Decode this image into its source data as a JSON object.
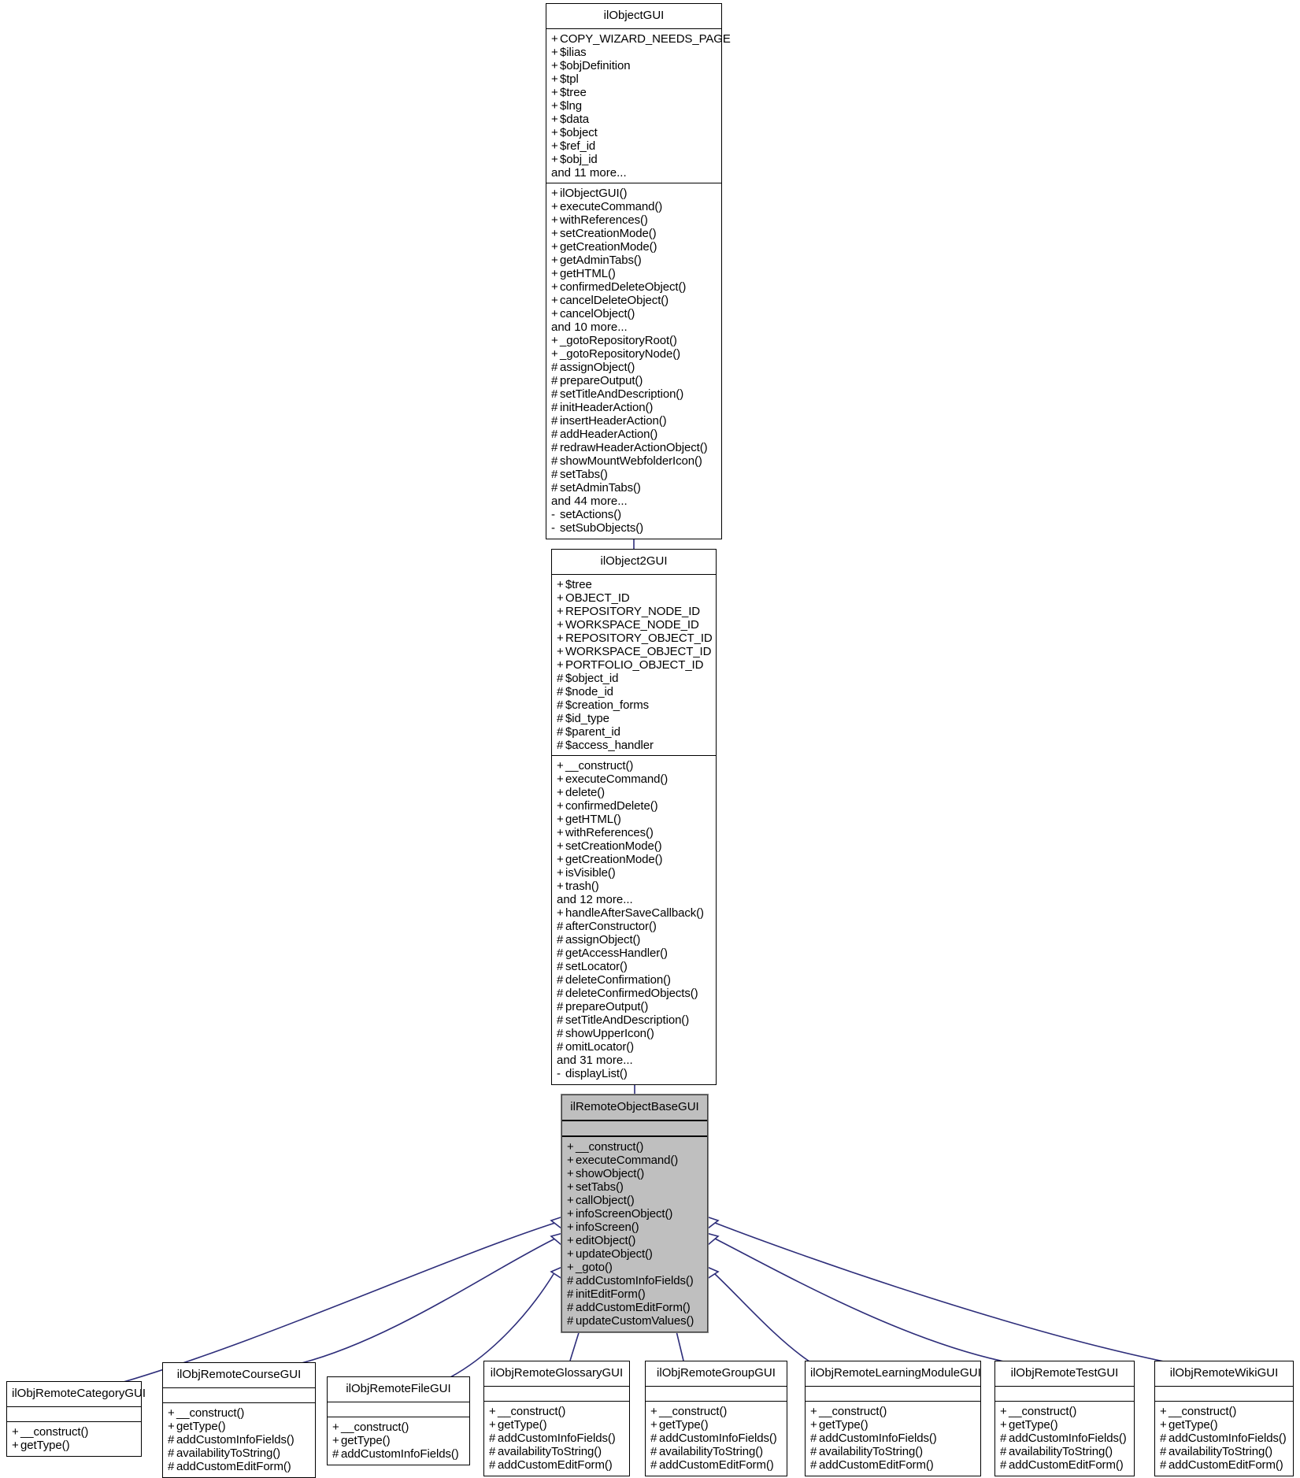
{
  "diagram": {
    "kind": "uml-class-inheritance-diagram",
    "focus_class": "ilRemoteObjectBaseGUI",
    "edge_color": "#2d2d7a",
    "highlight_fill": "#bfbfbf",
    "line_color": "#000000",
    "background": "#ffffff"
  },
  "classes": [
    {
      "id": "ilObjectGUI",
      "name": "ilObjectGUI",
      "highlighted": false,
      "attributes": [
        {
          "vis": "+",
          "name": "COPY_WIZARD_NEEDS_PAGE"
        },
        {
          "vis": "+",
          "name": "$ilias"
        },
        {
          "vis": "+",
          "name": "$objDefinition"
        },
        {
          "vis": "+",
          "name": "$tpl"
        },
        {
          "vis": "+",
          "name": "$tree"
        },
        {
          "vis": "+",
          "name": "$lng"
        },
        {
          "vis": "+",
          "name": "$data"
        },
        {
          "vis": "+",
          "name": "$object"
        },
        {
          "vis": "+",
          "name": "$ref_id"
        },
        {
          "vis": "+",
          "name": "$obj_id"
        },
        {
          "vis": "",
          "name": "and 11 more..."
        }
      ],
      "operations": [
        {
          "vis": "+",
          "name": "ilObjectGUI()"
        },
        {
          "vis": "+",
          "name": "executeCommand()"
        },
        {
          "vis": "+",
          "name": "withReferences()"
        },
        {
          "vis": "+",
          "name": "setCreationMode()"
        },
        {
          "vis": "+",
          "name": "getCreationMode()"
        },
        {
          "vis": "+",
          "name": "getAdminTabs()"
        },
        {
          "vis": "+",
          "name": "getHTML()"
        },
        {
          "vis": "+",
          "name": "confirmedDeleteObject()"
        },
        {
          "vis": "+",
          "name": "cancelDeleteObject()"
        },
        {
          "vis": "+",
          "name": "cancelObject()"
        },
        {
          "vis": "",
          "name": "and 10 more..."
        },
        {
          "vis": "+",
          "name": "_gotoRepositoryRoot()"
        },
        {
          "vis": "+",
          "name": "_gotoRepositoryNode()"
        },
        {
          "vis": "#",
          "name": "assignObject()"
        },
        {
          "vis": "#",
          "name": "prepareOutput()"
        },
        {
          "vis": "#",
          "name": "setTitleAndDescription()"
        },
        {
          "vis": "#",
          "name": "initHeaderAction()"
        },
        {
          "vis": "#",
          "name": "insertHeaderAction()"
        },
        {
          "vis": "#",
          "name": "addHeaderAction()"
        },
        {
          "vis": "#",
          "name": "redrawHeaderActionObject()"
        },
        {
          "vis": "#",
          "name": "showMountWebfolderIcon()"
        },
        {
          "vis": "#",
          "name": "setTabs()"
        },
        {
          "vis": "#",
          "name": "setAdminTabs()"
        },
        {
          "vis": "",
          "name": "and 44 more..."
        },
        {
          "vis": "-",
          "name": "setActions()"
        },
        {
          "vis": "-",
          "name": "setSubObjects()"
        }
      ]
    },
    {
      "id": "ilObject2GUI",
      "name": "ilObject2GUI",
      "highlighted": false,
      "attributes": [
        {
          "vis": "+",
          "name": "$tree"
        },
        {
          "vis": "+",
          "name": "OBJECT_ID"
        },
        {
          "vis": "+",
          "name": "REPOSITORY_NODE_ID"
        },
        {
          "vis": "+",
          "name": "WORKSPACE_NODE_ID"
        },
        {
          "vis": "+",
          "name": "REPOSITORY_OBJECT_ID"
        },
        {
          "vis": "+",
          "name": "WORKSPACE_OBJECT_ID"
        },
        {
          "vis": "+",
          "name": "PORTFOLIO_OBJECT_ID"
        },
        {
          "vis": "#",
          "name": "$object_id"
        },
        {
          "vis": "#",
          "name": "$node_id"
        },
        {
          "vis": "#",
          "name": "$creation_forms"
        },
        {
          "vis": "#",
          "name": "$id_type"
        },
        {
          "vis": "#",
          "name": "$parent_id"
        },
        {
          "vis": "#",
          "name": "$access_handler"
        }
      ],
      "operations": [
        {
          "vis": "+",
          "name": "__construct()"
        },
        {
          "vis": "+",
          "name": "executeCommand()"
        },
        {
          "vis": "+",
          "name": "delete()"
        },
        {
          "vis": "+",
          "name": "confirmedDelete()"
        },
        {
          "vis": "+",
          "name": "getHTML()"
        },
        {
          "vis": "+",
          "name": "withReferences()"
        },
        {
          "vis": "+",
          "name": "setCreationMode()"
        },
        {
          "vis": "+",
          "name": "getCreationMode()"
        },
        {
          "vis": "+",
          "name": "isVisible()"
        },
        {
          "vis": "+",
          "name": "trash()"
        },
        {
          "vis": "",
          "name": "and 12 more..."
        },
        {
          "vis": "+",
          "name": "handleAfterSaveCallback()"
        },
        {
          "vis": "#",
          "name": "afterConstructor()"
        },
        {
          "vis": "#",
          "name": "assignObject()"
        },
        {
          "vis": "#",
          "name": "getAccessHandler()"
        },
        {
          "vis": "#",
          "name": "setLocator()"
        },
        {
          "vis": "#",
          "name": "deleteConfirmation()"
        },
        {
          "vis": "#",
          "name": "deleteConfirmedObjects()"
        },
        {
          "vis": "#",
          "name": "prepareOutput()"
        },
        {
          "vis": "#",
          "name": "setTitleAndDescription()"
        },
        {
          "vis": "#",
          "name": "showUpperIcon()"
        },
        {
          "vis": "#",
          "name": "omitLocator()"
        },
        {
          "vis": "",
          "name": "and 31 more..."
        },
        {
          "vis": "-",
          "name": "displayList()"
        }
      ]
    },
    {
      "id": "ilRemoteObjectBaseGUI",
      "name": "ilRemoteObjectBaseGUI",
      "highlighted": true,
      "attributes": [],
      "operations": [
        {
          "vis": "+",
          "name": "__construct()"
        },
        {
          "vis": "+",
          "name": "executeCommand()"
        },
        {
          "vis": "+",
          "name": "showObject()"
        },
        {
          "vis": "+",
          "name": "setTabs()"
        },
        {
          "vis": "+",
          "name": "callObject()"
        },
        {
          "vis": "+",
          "name": "infoScreenObject()"
        },
        {
          "vis": "+",
          "name": "infoScreen()"
        },
        {
          "vis": "+",
          "name": "editObject()"
        },
        {
          "vis": "+",
          "name": "updateObject()"
        },
        {
          "vis": "+",
          "name": "_goto()"
        },
        {
          "vis": "#",
          "name": "addCustomInfoFields()"
        },
        {
          "vis": "#",
          "name": "initEditForm()"
        },
        {
          "vis": "#",
          "name": "addCustomEditForm()"
        },
        {
          "vis": "#",
          "name": "updateCustomValues()"
        }
      ]
    },
    {
      "id": "ilObjRemoteCategoryGUI",
      "name": "ilObjRemoteCategoryGUI",
      "highlighted": false,
      "attributes": [],
      "operations": [
        {
          "vis": "+",
          "name": "__construct()"
        },
        {
          "vis": "+",
          "name": "getType()"
        }
      ]
    },
    {
      "id": "ilObjRemoteCourseGUI",
      "name": "ilObjRemoteCourseGUI",
      "highlighted": false,
      "attributes": [],
      "operations": [
        {
          "vis": "+",
          "name": "__construct()"
        },
        {
          "vis": "+",
          "name": "getType()"
        },
        {
          "vis": "#",
          "name": "addCustomInfoFields()"
        },
        {
          "vis": "#",
          "name": "availabilityToString()"
        },
        {
          "vis": "#",
          "name": "addCustomEditForm()"
        }
      ]
    },
    {
      "id": "ilObjRemoteFileGUI",
      "name": "ilObjRemoteFileGUI",
      "highlighted": false,
      "attributes": [],
      "operations": [
        {
          "vis": "+",
          "name": "__construct()"
        },
        {
          "vis": "+",
          "name": "getType()"
        },
        {
          "vis": "#",
          "name": "addCustomInfoFields()"
        }
      ]
    },
    {
      "id": "ilObjRemoteGlossaryGUI",
      "name": "ilObjRemoteGlossaryGUI",
      "highlighted": false,
      "attributes": [],
      "operations": [
        {
          "vis": "+",
          "name": "__construct()"
        },
        {
          "vis": "+",
          "name": "getType()"
        },
        {
          "vis": "#",
          "name": "addCustomInfoFields()"
        },
        {
          "vis": "#",
          "name": "availabilityToString()"
        },
        {
          "vis": "#",
          "name": "addCustomEditForm()"
        }
      ]
    },
    {
      "id": "ilObjRemoteGroupGUI",
      "name": "ilObjRemoteGroupGUI",
      "highlighted": false,
      "attributes": [],
      "operations": [
        {
          "vis": "+",
          "name": "__construct()"
        },
        {
          "vis": "+",
          "name": "getType()"
        },
        {
          "vis": "#",
          "name": "addCustomInfoFields()"
        },
        {
          "vis": "#",
          "name": "availabilityToString()"
        },
        {
          "vis": "#",
          "name": "addCustomEditForm()"
        }
      ]
    },
    {
      "id": "ilObjRemoteLearningModuleGUI",
      "name": "ilObjRemoteLearningModuleGUI",
      "highlighted": false,
      "attributes": [],
      "operations": [
        {
          "vis": "+",
          "name": "__construct()"
        },
        {
          "vis": "+",
          "name": "getType()"
        },
        {
          "vis": "#",
          "name": "addCustomInfoFields()"
        },
        {
          "vis": "#",
          "name": "availabilityToString()"
        },
        {
          "vis": "#",
          "name": "addCustomEditForm()"
        }
      ]
    },
    {
      "id": "ilObjRemoteTestGUI",
      "name": "ilObjRemoteTestGUI",
      "highlighted": false,
      "attributes": [],
      "operations": [
        {
          "vis": "+",
          "name": "__construct()"
        },
        {
          "vis": "+",
          "name": "getType()"
        },
        {
          "vis": "#",
          "name": "addCustomInfoFields()"
        },
        {
          "vis": "#",
          "name": "availabilityToString()"
        },
        {
          "vis": "#",
          "name": "addCustomEditForm()"
        }
      ]
    },
    {
      "id": "ilObjRemoteWikiGUI",
      "name": "ilObjRemoteWikiGUI",
      "highlighted": false,
      "attributes": [],
      "operations": [
        {
          "vis": "+",
          "name": "__construct()"
        },
        {
          "vis": "+",
          "name": "getType()"
        },
        {
          "vis": "#",
          "name": "addCustomInfoFields()"
        },
        {
          "vis": "#",
          "name": "availabilityToString()"
        },
        {
          "vis": "#",
          "name": "addCustomEditForm()"
        }
      ]
    }
  ],
  "inheritance_edges": [
    {
      "from": "ilObject2GUI",
      "to": "ilObjectGUI",
      "style": "straight"
    },
    {
      "from": "ilRemoteObjectBaseGUI",
      "to": "ilObject2GUI",
      "style": "straight"
    },
    {
      "from": "ilObjRemoteCategoryGUI",
      "to": "ilRemoteObjectBaseGUI",
      "style": "curved"
    },
    {
      "from": "ilObjRemoteCourseGUI",
      "to": "ilRemoteObjectBaseGUI",
      "style": "curved"
    },
    {
      "from": "ilObjRemoteFileGUI",
      "to": "ilRemoteObjectBaseGUI",
      "style": "curved"
    },
    {
      "from": "ilObjRemoteGlossaryGUI",
      "to": "ilRemoteObjectBaseGUI",
      "style": "straight"
    },
    {
      "from": "ilObjRemoteGroupGUI",
      "to": "ilRemoteObjectBaseGUI",
      "style": "straight"
    },
    {
      "from": "ilObjRemoteLearningModuleGUI",
      "to": "ilRemoteObjectBaseGUI",
      "style": "curved"
    },
    {
      "from": "ilObjRemoteTestGUI",
      "to": "ilRemoteObjectBaseGUI",
      "style": "curved"
    },
    {
      "from": "ilObjRemoteWikiGUI",
      "to": "ilRemoteObjectBaseGUI",
      "style": "curved"
    }
  ]
}
